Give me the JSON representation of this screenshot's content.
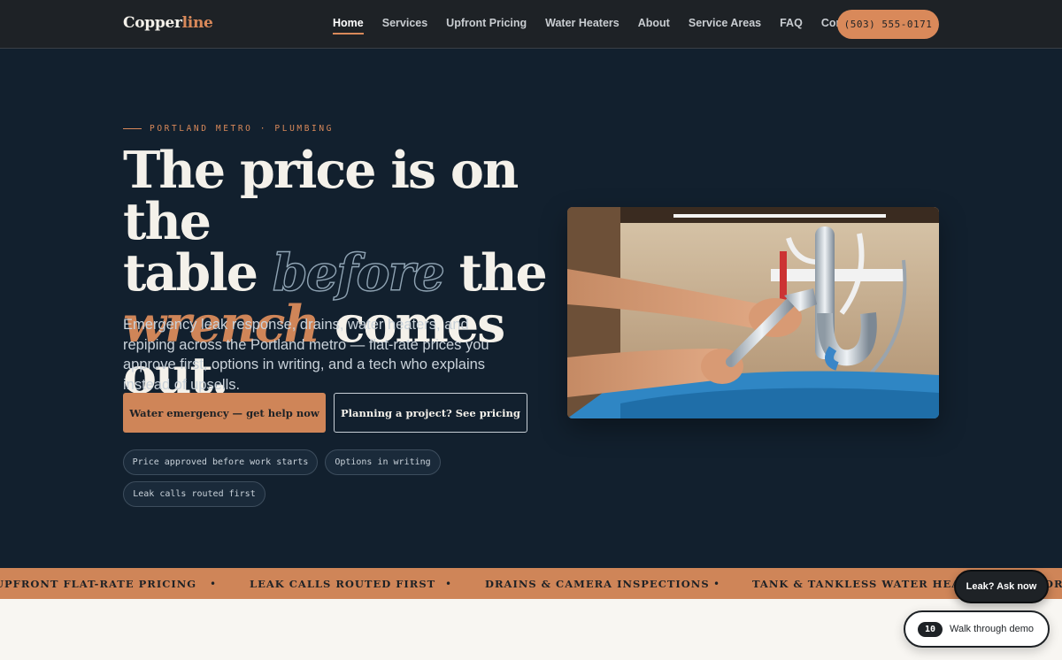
{
  "brand": {
    "logo_main": "Copper",
    "logo_accent": "line",
    "accent_color": "#d9895a"
  },
  "nav": {
    "links": [
      "Home",
      "Services",
      "Upfront Pricing",
      "Water Heaters",
      "About",
      "Service Areas",
      "FAQ",
      "Contact"
    ],
    "active": "Home",
    "phone": "(503) 555-0171"
  },
  "hero": {
    "eyebrow": "PORTLAND METRO · PLUMBING",
    "headline": {
      "line1": "The price is on the",
      "line2a": "table",
      "line2_outline": "before",
      "line2b": "the",
      "line3_accent": "wrench",
      "line3b": "comes out."
    },
    "subtext": "Emergency leak response, drains, water heaters, and repiping across the Portland metro — flat-rate prices you approve first, options in writing, and a tech who explains instead of upsells.",
    "primary_cta": "Water emergency — get help now",
    "secondary_cta": "Planning a project? See pricing",
    "chips": [
      "Price approved before work starts",
      "Options in writing",
      "Leak calls routed first"
    ],
    "image_icon": "plumber-under-sink-photo"
  },
  "marquee": {
    "items": [
      "UPFRONT FLAT-RATE PRICING",
      "LEAK CALLS ROUTED FIRST",
      "DRAINS & CAMERA INSPECTIONS",
      "TANK & TANKLESS WATER HEATERS",
      "OR"
    ],
    "separator": "•"
  },
  "floating": {
    "leak_button": "Leak? Ask now",
    "demo_badge": "10",
    "demo_label": "Walk through demo"
  }
}
